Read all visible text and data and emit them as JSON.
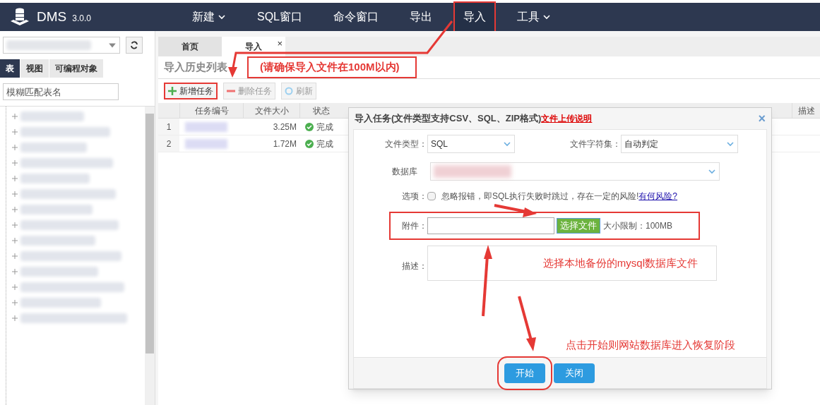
{
  "app": {
    "name": "DMS",
    "version": "3.0.0"
  },
  "nav": [
    {
      "label": "新建",
      "dropdown": true,
      "selected": false
    },
    {
      "label": "SQL窗口",
      "dropdown": false,
      "selected": false
    },
    {
      "label": "命令窗口",
      "dropdown": false,
      "selected": false
    },
    {
      "label": "导出",
      "dropdown": false,
      "selected": false
    },
    {
      "label": "导入",
      "dropdown": false,
      "selected": true
    },
    {
      "label": "工具",
      "dropdown": true,
      "selected": false
    }
  ],
  "sidebar": {
    "tabs": [
      {
        "label": "表",
        "selected": true
      },
      {
        "label": "视图",
        "selected": false
      },
      {
        "label": "可编程对象",
        "selected": false
      }
    ],
    "search": {
      "placeholder": "模糊匹配表名"
    }
  },
  "tabs": [
    {
      "label": "首页",
      "selected": false
    },
    {
      "label": "导入",
      "selected": true,
      "close": "×"
    }
  ],
  "section": {
    "title": "导入历史列表",
    "note": "(请确保导入文件在100M以内)"
  },
  "toolbar": [
    {
      "label": "新增任务",
      "kind": "add",
      "disabled": false
    },
    {
      "label": "删除任务",
      "kind": "delete",
      "disabled": true
    },
    {
      "label": "刷新",
      "kind": "refresh",
      "disabled": true
    }
  ],
  "table": {
    "columns": [
      "任务编号",
      "文件大小",
      "状态",
      "描述"
    ],
    "rows": [
      {
        "index": "1",
        "size": "3.25M",
        "status": "完成"
      },
      {
        "index": "2",
        "size": "1.72M",
        "status": "完成"
      }
    ]
  },
  "dialog": {
    "title": "导入任务(文件类型支持CSV、SQL、ZIP格式)",
    "help_link": "文件上传说明",
    "close": "×",
    "file_type": {
      "label": "文件类型：",
      "value": "SQL"
    },
    "charset": {
      "label": "文件字符集：",
      "value": "自动判定"
    },
    "database": {
      "label": "数据库"
    },
    "option": {
      "label": "选项：",
      "checked": false,
      "text": "忽略报错，即SQL执行失败时跳过，存在一定的风险!",
      "link": "有何风险?"
    },
    "attachment": {
      "label": "附件：",
      "button": "选择文件",
      "limit": "大小限制：100MB"
    },
    "description": {
      "label": "描述："
    },
    "buttons": [
      "开始",
      "关闭"
    ]
  },
  "annotations": [
    "选择本地备份的mysql数据库文件",
    "点击开始则网站数据库进入恢复阶段"
  ]
}
